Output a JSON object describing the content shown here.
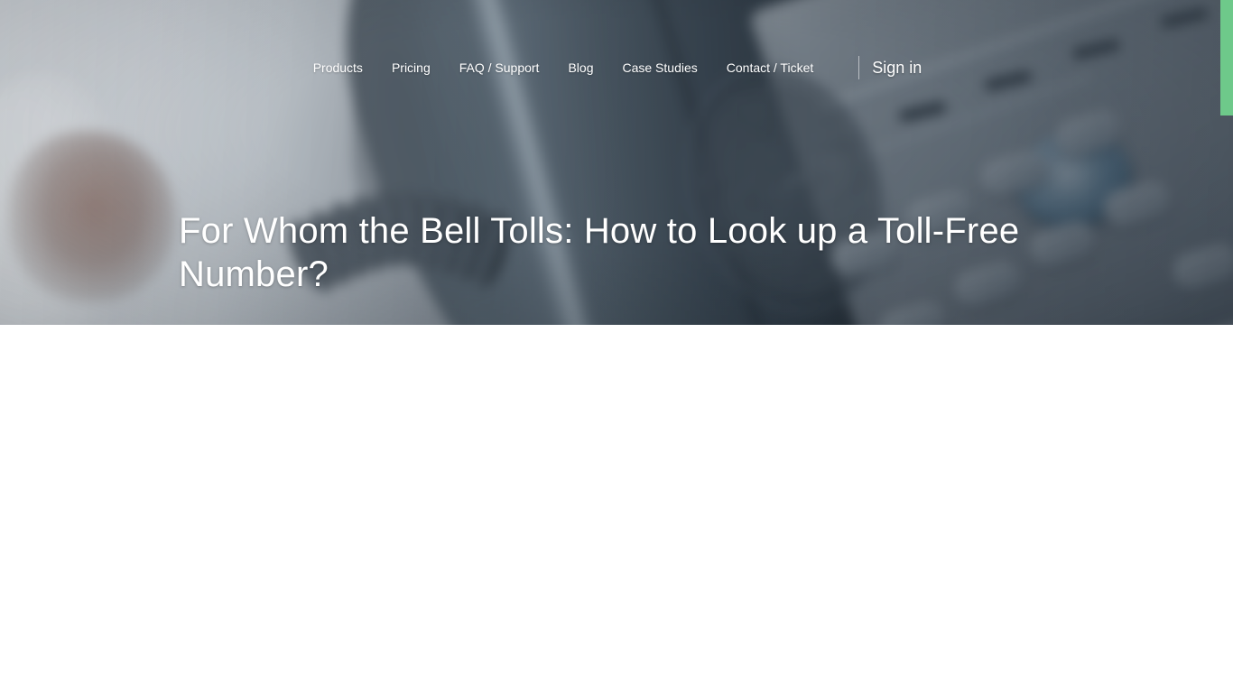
{
  "site": {
    "accent_color": "#6ec98a",
    "nav_text_color": "#ffffff"
  },
  "nav": {
    "items": [
      {
        "label": "Products"
      },
      {
        "label": "Pricing"
      },
      {
        "label": "FAQ / Support"
      },
      {
        "label": "Blog"
      },
      {
        "label": "Case Studies"
      },
      {
        "label": "Contact / Ticket"
      }
    ],
    "sign_in_label": "Sign in"
  },
  "hero": {
    "title": "For Whom the Bell Tolls: How to Look up a Toll-Free Number?",
    "background_description": "blurred close-up photograph of a dark VoIP desk phone handset, speaker grille, keypad and coiled cord",
    "overlay_tint": "#3a4652"
  },
  "article": {
    "body_text": ""
  }
}
